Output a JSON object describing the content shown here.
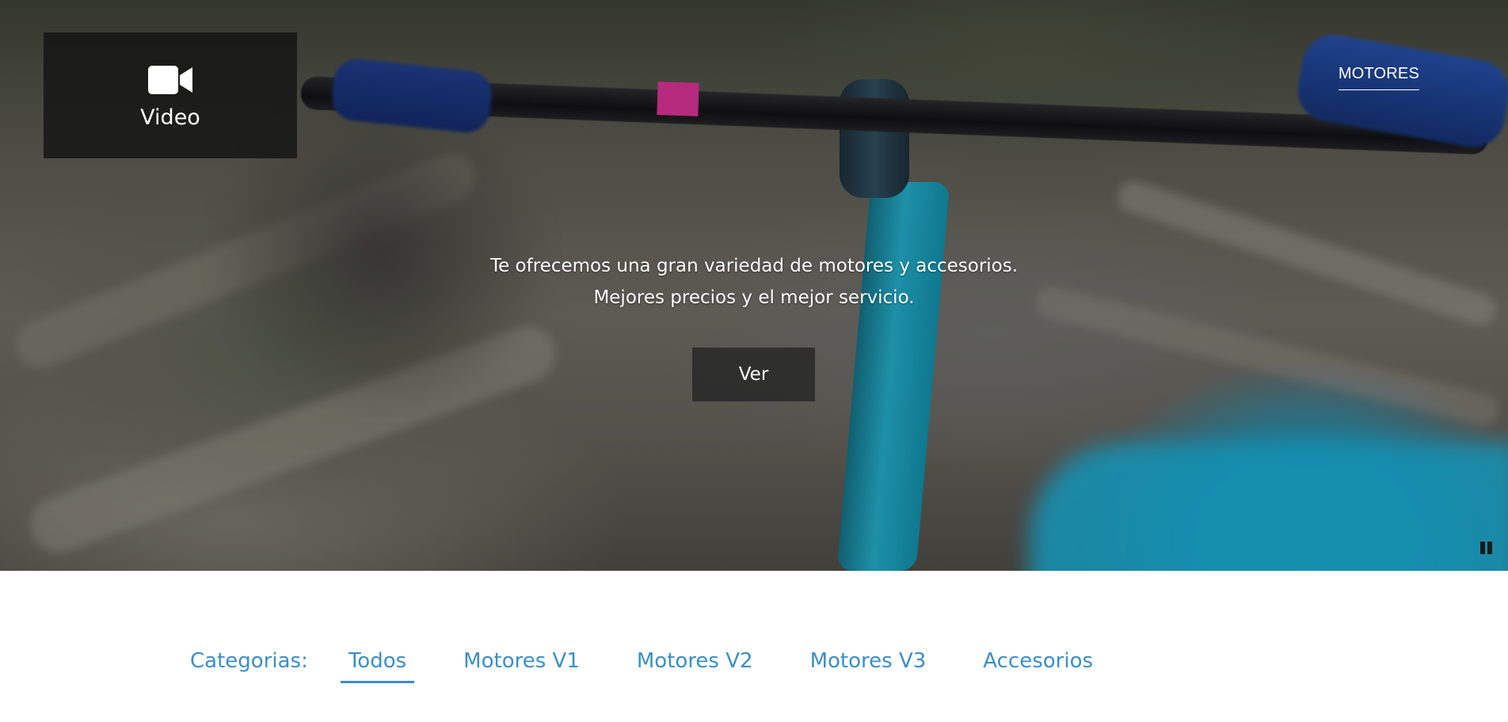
{
  "nav": {
    "motores_label": "MOTORES"
  },
  "video_badge": {
    "icon": "video-camera-icon",
    "label": "Video"
  },
  "hero": {
    "line1": "Te ofrecemos una gran variedad de motores y accesorios.",
    "line2": "Mejores precios y el mejor servicio.",
    "cta_label": "Ver",
    "pause_icon": "pause-icon"
  },
  "categories": {
    "label": "Categorias:",
    "tabs": [
      {
        "label": "Todos",
        "active": true
      },
      {
        "label": "Motores V1",
        "active": false
      },
      {
        "label": "Motores V2",
        "active": false
      },
      {
        "label": "Motores V3",
        "active": false
      },
      {
        "label": "Accesorios",
        "active": false
      }
    ]
  },
  "colors": {
    "accent": "#3a8fc8",
    "badge_bg": "#141414",
    "button_bg": "#282828"
  }
}
